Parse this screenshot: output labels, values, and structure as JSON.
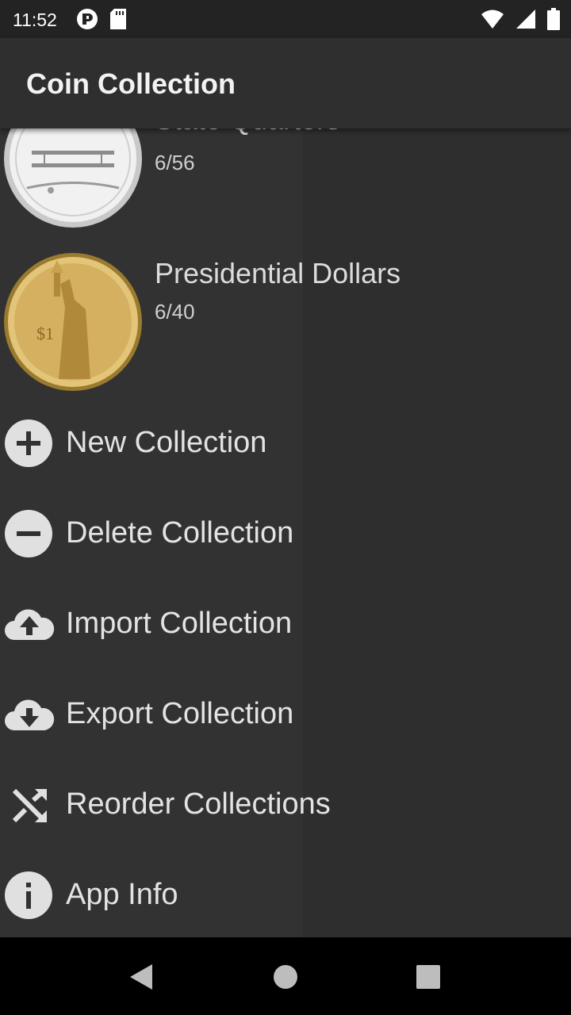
{
  "status_bar": {
    "time": "11:52",
    "icons_left": [
      "notification-app-icon",
      "sd-card-icon"
    ],
    "icons_right": [
      "wifi-icon",
      "cell-signal-icon",
      "battery-icon"
    ]
  },
  "app_bar": {
    "title": "Coin Collection"
  },
  "collections": [
    {
      "name": "State Quarters",
      "count": "6/56",
      "image": "state-quarter-coin"
    },
    {
      "name": "Presidential Dollars",
      "count": "6/40",
      "image": "presidential-dollar-coin"
    }
  ],
  "menu": [
    {
      "label": "New Collection",
      "icon": "add-circle-icon"
    },
    {
      "label": "Delete Collection",
      "icon": "remove-circle-icon"
    },
    {
      "label": "Import Collection",
      "icon": "cloud-upload-icon"
    },
    {
      "label": "Export Collection",
      "icon": "cloud-download-icon"
    },
    {
      "label": "Reorder Collections",
      "icon": "shuffle-icon"
    },
    {
      "label": "App Info",
      "icon": "info-icon"
    }
  ],
  "nav_bar": {
    "buttons": [
      "back-button",
      "home-button",
      "recents-button"
    ]
  },
  "colors": {
    "background": "#323232",
    "app_bar": "#2f2f2f",
    "icon": "#e0e0e0",
    "text": "#e3e3e3"
  }
}
